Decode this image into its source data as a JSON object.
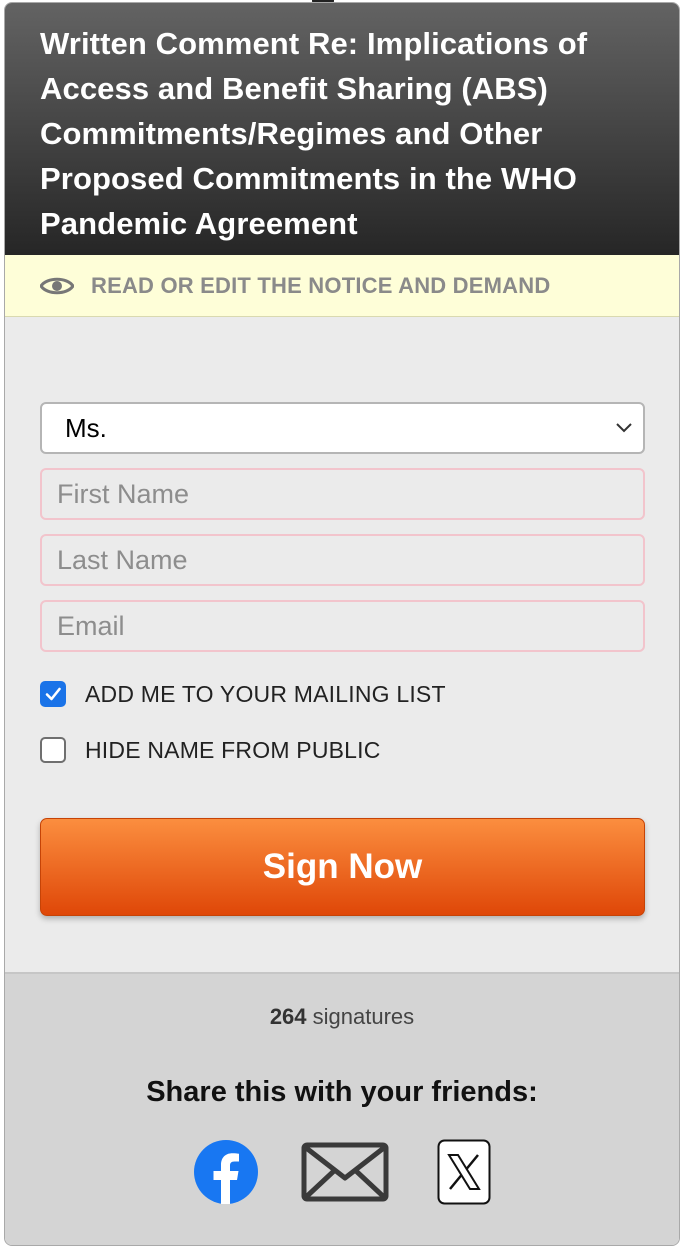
{
  "header": {
    "title": "Written Comment Re: Implications of Access and Benefit Sharing (ABS) Commitments/Regimes and Other Proposed Commitments in the WHO Pandemic Agreement"
  },
  "notice_bar": {
    "label": "READ OR EDIT THE NOTICE AND DEMAND",
    "icon": "eye-icon"
  },
  "form": {
    "salutation": {
      "value": "Ms."
    },
    "first_name": {
      "value": "",
      "placeholder": "First Name"
    },
    "last_name": {
      "value": "",
      "placeholder": "Last Name"
    },
    "email": {
      "value": "",
      "placeholder": "Email"
    },
    "mailing_list": {
      "label": "ADD ME TO YOUR MAILING LIST",
      "checked": true
    },
    "hide_name": {
      "label": "HIDE NAME FROM PUBLIC",
      "checked": false
    },
    "submit_label": "Sign Now"
  },
  "footer": {
    "signature_count": "264",
    "signature_suffix": "signatures",
    "share_title": "Share this with your friends:",
    "share_icons": [
      "facebook-icon",
      "email-icon",
      "x-icon"
    ]
  },
  "colors": {
    "header_top": "#636363",
    "header_bottom": "#262626",
    "notice_bg": "#fefed8",
    "button_top": "#fb8e3f",
    "button_bottom": "#df4708",
    "checkbox_checked": "#1a73e8",
    "facebook_blue": "#1877f2"
  }
}
